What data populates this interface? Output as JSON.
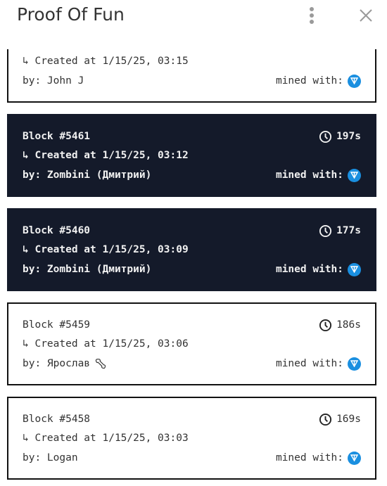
{
  "header": {
    "title": "Proof Of Fun",
    "menu_icon": "more-vertical-icon",
    "close_icon": "close-icon"
  },
  "labels": {
    "mined_with": "mined with:"
  },
  "colors": {
    "dark_card": "#141a2a",
    "ton_blue": "#1a8fe0"
  },
  "blocks": [
    {
      "block": "",
      "time": "",
      "created": "↳ Created at 1/15/25, 03:15",
      "by": "by: John J",
      "dark": false,
      "extra_icon": ""
    },
    {
      "block": "Block #5461",
      "time": "197s",
      "created": "↳ Created at 1/15/25, 03:12",
      "by": "by: Zombini (Дмитрий)",
      "dark": true,
      "extra_icon": ""
    },
    {
      "block": "Block #5460",
      "time": "177s",
      "created": "↳ Created at 1/15/25, 03:09",
      "by": "by: Zombini (Дмитрий)",
      "dark": true,
      "extra_icon": ""
    },
    {
      "block": "Block #5459",
      "time": "186s",
      "created": "↳ Created at 1/15/25, 03:06",
      "by": "by: Ярослав",
      "dark": false,
      "extra_icon": "bone-icon"
    },
    {
      "block": "Block #5458",
      "time": "169s",
      "created": "↳ Created at 1/15/25, 03:03",
      "by": "by: Logan",
      "dark": false,
      "extra_icon": ""
    }
  ]
}
